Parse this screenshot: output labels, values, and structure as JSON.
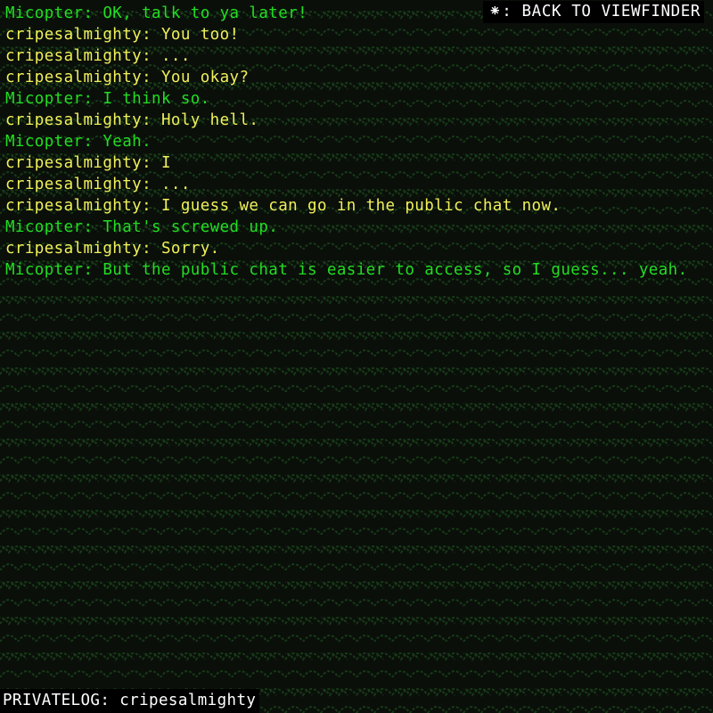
{
  "colors": {
    "background": "#0a0f0a",
    "pattern": "#173a17",
    "micopter": "#22dd22",
    "cripesalmighty": "#f0f05a",
    "ui_text": "#ffffff",
    "ui_bg": "#000000"
  },
  "header": {
    "back_label": "⁕: BACK TO VIEWFINDER"
  },
  "footer": {
    "log_label": "PRIVATELOG: cripesalmighty"
  },
  "messages": [
    {
      "speaker": "Micopter",
      "text": "Micopter: OK, talk to ya later!"
    },
    {
      "speaker": "cripesalmighty",
      "text": "cripesalmighty: You too!"
    },
    {
      "speaker": "cripesalmighty",
      "text": "cripesalmighty: ..."
    },
    {
      "speaker": "cripesalmighty",
      "text": "cripesalmighty: You okay?"
    },
    {
      "speaker": "Micopter",
      "text": "Micopter: I think so."
    },
    {
      "speaker": "cripesalmighty",
      "text": "cripesalmighty: Holy hell."
    },
    {
      "speaker": "Micopter",
      "text": "Micopter: Yeah."
    },
    {
      "speaker": "cripesalmighty",
      "text": "cripesalmighty: I"
    },
    {
      "speaker": "cripesalmighty",
      "text": "cripesalmighty: ..."
    },
    {
      "speaker": "cripesalmighty",
      "text": "cripesalmighty: I guess we can go in the public chat now."
    },
    {
      "speaker": "Micopter",
      "text": "Micopter: That's screwed up."
    },
    {
      "speaker": "cripesalmighty",
      "text": "cripesalmighty: Sorry."
    },
    {
      "speaker": "Micopter",
      "text": "Micopter: But the public chat is easier to access, so I guess... yeah."
    }
  ]
}
